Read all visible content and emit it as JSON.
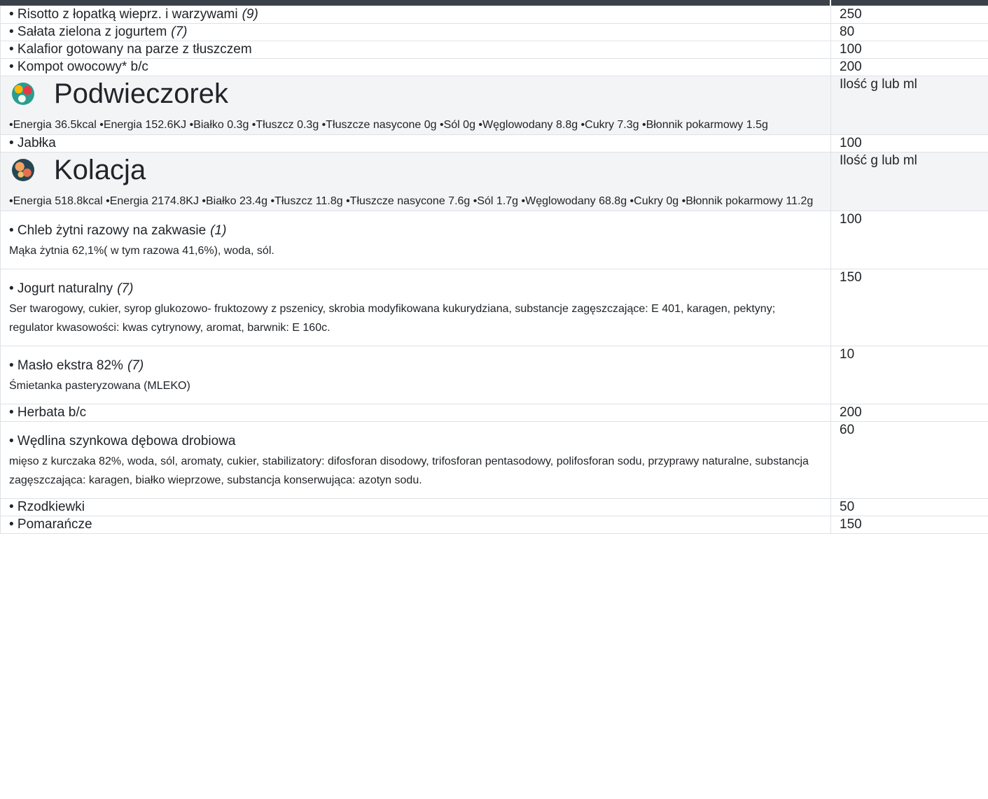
{
  "colors": {
    "topbar": "#3b4149",
    "section_bg": "#f3f4f6",
    "border": "#dee2e6",
    "text": "#212529"
  },
  "lunch_items": [
    {
      "name": "• Risotto z łopatką wieprz. i warzywami",
      "allergen": "(9)",
      "qty": "250"
    },
    {
      "name": "• Sałata zielona z jogurtem",
      "allergen": "(7)",
      "qty": "80"
    },
    {
      "name": "• Kalafior gotowany na parze z tłuszczem",
      "allergen": "",
      "qty": "100"
    },
    {
      "name": "• Kompot owocowy* b/c",
      "allergen": "",
      "qty": "200"
    }
  ],
  "podwieczorek": {
    "icon": "fruit-plate-icon",
    "title": "Podwieczorek",
    "qty_header": "Ilość g lub ml",
    "nutrition": "•Energia 36.5kcal •Energia 152.6KJ •Białko 0.3g •Tłuszcz 0.3g •Tłuszcze nasycone 0g •Sól 0g •Węglowodany 8.8g •Cukry 7.3g •Błonnik pokarmowy 1.5g",
    "items": [
      {
        "name": "• Jabłka",
        "qty": "100"
      }
    ]
  },
  "kolacja": {
    "icon": "dinner-plate-icon",
    "title": "Kolacja",
    "qty_header": "Ilość g lub ml",
    "nutrition": "•Energia 518.8kcal •Energia 2174.8KJ •Białko 23.4g •Tłuszcz 11.8g •Tłuszcze nasycone 7.6g •Sól 1.7g •Węglowodany 68.8g •Cukry 0g •Błonnik pokarmowy 11.2g",
    "items": [
      {
        "name": "• Chleb żytni razowy na zakwasie",
        "allergen": "(1)",
        "ingredients": "Mąka żytnia 62,1%( w tym razowa 41,6%), woda, sól.",
        "qty": "100"
      },
      {
        "name": "• Jogurt naturalny",
        "allergen": "(7)",
        "ingredients": "Ser twarogowy, cukier, syrop glukozowo- fruktozowy z pszenicy, skrobia modyfikowana kukurydziana, substancje zagęszczające: E 401, karagen, pektyny; regulator kwasowości: kwas cytrynowy, aromat, barwnik: E 160c.",
        "qty": "150"
      },
      {
        "name": "• Masło ekstra 82%",
        "allergen": "(7)",
        "ingredients": "Śmietanka pasteryzowana (MLEKO)",
        "qty": "10"
      },
      {
        "name": "• Herbata b/c",
        "qty": "200"
      },
      {
        "name": "• Wędlina szynkowa dębowa drobiowa",
        "ingredients": "mięso z kurczaka 82%, woda, sól, aromaty, cukier, stabilizatory: difosforan disodowy, trifosforan pentasodowy, polifosforan sodu, przyprawy naturalne, substancja zagęszczająca: karagen, białko wieprzowe, substancja konserwująca: azotyn sodu.",
        "qty": "60"
      },
      {
        "name": "• Rzodkiewki",
        "qty": "50"
      },
      {
        "name": "• Pomarańcze",
        "qty": "150"
      }
    ]
  }
}
